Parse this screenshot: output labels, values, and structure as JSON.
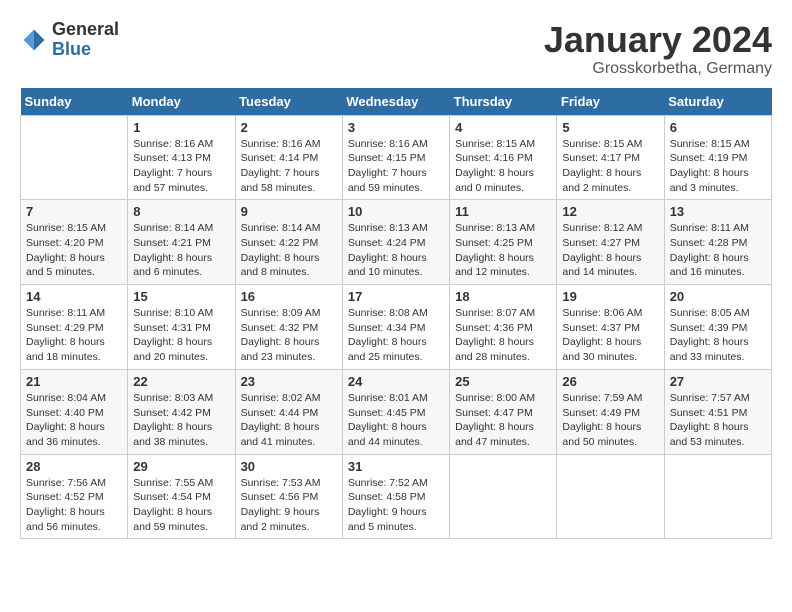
{
  "header": {
    "logo_general": "General",
    "logo_blue": "Blue",
    "month_title": "January 2024",
    "subtitle": "Grosskorbetha, Germany"
  },
  "weekdays": [
    "Sunday",
    "Monday",
    "Tuesday",
    "Wednesday",
    "Thursday",
    "Friday",
    "Saturday"
  ],
  "weeks": [
    [
      {
        "day": "",
        "sunrise": "",
        "sunset": "",
        "daylight": ""
      },
      {
        "day": "1",
        "sunrise": "Sunrise: 8:16 AM",
        "sunset": "Sunset: 4:13 PM",
        "daylight": "Daylight: 7 hours and 57 minutes."
      },
      {
        "day": "2",
        "sunrise": "Sunrise: 8:16 AM",
        "sunset": "Sunset: 4:14 PM",
        "daylight": "Daylight: 7 hours and 58 minutes."
      },
      {
        "day": "3",
        "sunrise": "Sunrise: 8:16 AM",
        "sunset": "Sunset: 4:15 PM",
        "daylight": "Daylight: 7 hours and 59 minutes."
      },
      {
        "day": "4",
        "sunrise": "Sunrise: 8:15 AM",
        "sunset": "Sunset: 4:16 PM",
        "daylight": "Daylight: 8 hours and 0 minutes."
      },
      {
        "day": "5",
        "sunrise": "Sunrise: 8:15 AM",
        "sunset": "Sunset: 4:17 PM",
        "daylight": "Daylight: 8 hours and 2 minutes."
      },
      {
        "day": "6",
        "sunrise": "Sunrise: 8:15 AM",
        "sunset": "Sunset: 4:19 PM",
        "daylight": "Daylight: 8 hours and 3 minutes."
      }
    ],
    [
      {
        "day": "7",
        "sunrise": "Sunrise: 8:15 AM",
        "sunset": "Sunset: 4:20 PM",
        "daylight": "Daylight: 8 hours and 5 minutes."
      },
      {
        "day": "8",
        "sunrise": "Sunrise: 8:14 AM",
        "sunset": "Sunset: 4:21 PM",
        "daylight": "Daylight: 8 hours and 6 minutes."
      },
      {
        "day": "9",
        "sunrise": "Sunrise: 8:14 AM",
        "sunset": "Sunset: 4:22 PM",
        "daylight": "Daylight: 8 hours and 8 minutes."
      },
      {
        "day": "10",
        "sunrise": "Sunrise: 8:13 AM",
        "sunset": "Sunset: 4:24 PM",
        "daylight": "Daylight: 8 hours and 10 minutes."
      },
      {
        "day": "11",
        "sunrise": "Sunrise: 8:13 AM",
        "sunset": "Sunset: 4:25 PM",
        "daylight": "Daylight: 8 hours and 12 minutes."
      },
      {
        "day": "12",
        "sunrise": "Sunrise: 8:12 AM",
        "sunset": "Sunset: 4:27 PM",
        "daylight": "Daylight: 8 hours and 14 minutes."
      },
      {
        "day": "13",
        "sunrise": "Sunrise: 8:11 AM",
        "sunset": "Sunset: 4:28 PM",
        "daylight": "Daylight: 8 hours and 16 minutes."
      }
    ],
    [
      {
        "day": "14",
        "sunrise": "Sunrise: 8:11 AM",
        "sunset": "Sunset: 4:29 PM",
        "daylight": "Daylight: 8 hours and 18 minutes."
      },
      {
        "day": "15",
        "sunrise": "Sunrise: 8:10 AM",
        "sunset": "Sunset: 4:31 PM",
        "daylight": "Daylight: 8 hours and 20 minutes."
      },
      {
        "day": "16",
        "sunrise": "Sunrise: 8:09 AM",
        "sunset": "Sunset: 4:32 PM",
        "daylight": "Daylight: 8 hours and 23 minutes."
      },
      {
        "day": "17",
        "sunrise": "Sunrise: 8:08 AM",
        "sunset": "Sunset: 4:34 PM",
        "daylight": "Daylight: 8 hours and 25 minutes."
      },
      {
        "day": "18",
        "sunrise": "Sunrise: 8:07 AM",
        "sunset": "Sunset: 4:36 PM",
        "daylight": "Daylight: 8 hours and 28 minutes."
      },
      {
        "day": "19",
        "sunrise": "Sunrise: 8:06 AM",
        "sunset": "Sunset: 4:37 PM",
        "daylight": "Daylight: 8 hours and 30 minutes."
      },
      {
        "day": "20",
        "sunrise": "Sunrise: 8:05 AM",
        "sunset": "Sunset: 4:39 PM",
        "daylight": "Daylight: 8 hours and 33 minutes."
      }
    ],
    [
      {
        "day": "21",
        "sunrise": "Sunrise: 8:04 AM",
        "sunset": "Sunset: 4:40 PM",
        "daylight": "Daylight: 8 hours and 36 minutes."
      },
      {
        "day": "22",
        "sunrise": "Sunrise: 8:03 AM",
        "sunset": "Sunset: 4:42 PM",
        "daylight": "Daylight: 8 hours and 38 minutes."
      },
      {
        "day": "23",
        "sunrise": "Sunrise: 8:02 AM",
        "sunset": "Sunset: 4:44 PM",
        "daylight": "Daylight: 8 hours and 41 minutes."
      },
      {
        "day": "24",
        "sunrise": "Sunrise: 8:01 AM",
        "sunset": "Sunset: 4:45 PM",
        "daylight": "Daylight: 8 hours and 44 minutes."
      },
      {
        "day": "25",
        "sunrise": "Sunrise: 8:00 AM",
        "sunset": "Sunset: 4:47 PM",
        "daylight": "Daylight: 8 hours and 47 minutes."
      },
      {
        "day": "26",
        "sunrise": "Sunrise: 7:59 AM",
        "sunset": "Sunset: 4:49 PM",
        "daylight": "Daylight: 8 hours and 50 minutes."
      },
      {
        "day": "27",
        "sunrise": "Sunrise: 7:57 AM",
        "sunset": "Sunset: 4:51 PM",
        "daylight": "Daylight: 8 hours and 53 minutes."
      }
    ],
    [
      {
        "day": "28",
        "sunrise": "Sunrise: 7:56 AM",
        "sunset": "Sunset: 4:52 PM",
        "daylight": "Daylight: 8 hours and 56 minutes."
      },
      {
        "day": "29",
        "sunrise": "Sunrise: 7:55 AM",
        "sunset": "Sunset: 4:54 PM",
        "daylight": "Daylight: 8 hours and 59 minutes."
      },
      {
        "day": "30",
        "sunrise": "Sunrise: 7:53 AM",
        "sunset": "Sunset: 4:56 PM",
        "daylight": "Daylight: 9 hours and 2 minutes."
      },
      {
        "day": "31",
        "sunrise": "Sunrise: 7:52 AM",
        "sunset": "Sunset: 4:58 PM",
        "daylight": "Daylight: 9 hours and 5 minutes."
      },
      {
        "day": "",
        "sunrise": "",
        "sunset": "",
        "daylight": ""
      },
      {
        "day": "",
        "sunrise": "",
        "sunset": "",
        "daylight": ""
      },
      {
        "day": "",
        "sunrise": "",
        "sunset": "",
        "daylight": ""
      }
    ]
  ]
}
